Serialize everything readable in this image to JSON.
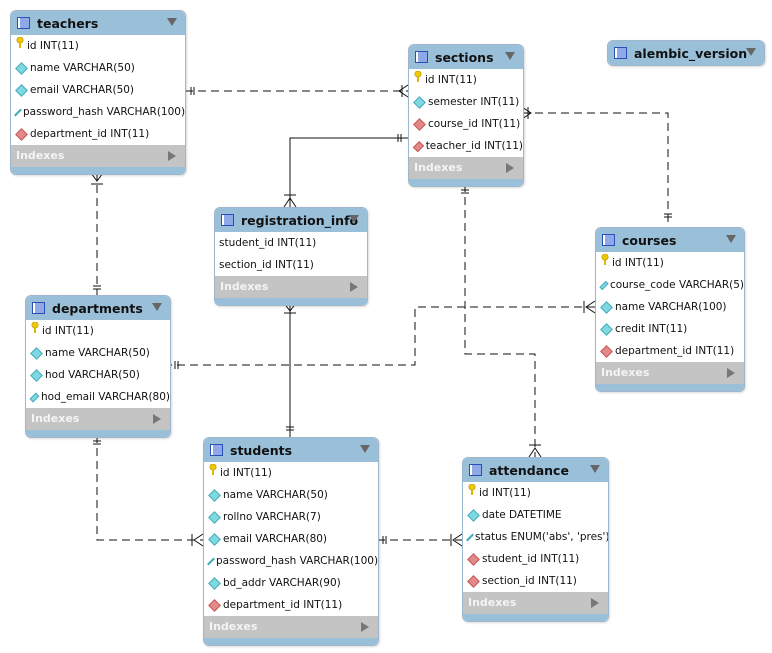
{
  "indexes_label": "Indexes",
  "tables": [
    {
      "id": "teachers",
      "name": "teachers",
      "columns": [
        {
          "kind": "pk",
          "text": "id INT(11)"
        },
        {
          "kind": "col",
          "text": "name VARCHAR(50)"
        },
        {
          "kind": "col",
          "text": "email VARCHAR(50)"
        },
        {
          "kind": "col",
          "text": "password_hash VARCHAR(100)"
        },
        {
          "kind": "fk",
          "text": "department_id INT(11)"
        }
      ]
    },
    {
      "id": "sections",
      "name": "sections",
      "columns": [
        {
          "kind": "pk",
          "text": "id INT(11)"
        },
        {
          "kind": "col",
          "text": "semester INT(11)"
        },
        {
          "kind": "fk",
          "text": "course_id INT(11)"
        },
        {
          "kind": "fk",
          "text": "teacher_id INT(11)"
        }
      ]
    },
    {
      "id": "alembic_version",
      "name": "alembic_version",
      "collapsed": true,
      "columns": []
    },
    {
      "id": "registration_info",
      "name": "registration_info",
      "columns": [
        {
          "kind": "none",
          "text": "student_id INT(11)"
        },
        {
          "kind": "none",
          "text": "section_id INT(11)"
        }
      ]
    },
    {
      "id": "courses",
      "name": "courses",
      "columns": [
        {
          "kind": "pk",
          "text": "id INT(11)"
        },
        {
          "kind": "col",
          "text": "course_code VARCHAR(5)"
        },
        {
          "kind": "col",
          "text": "name VARCHAR(100)"
        },
        {
          "kind": "col",
          "text": "credit INT(11)"
        },
        {
          "kind": "fk",
          "text": "department_id INT(11)"
        }
      ]
    },
    {
      "id": "departments",
      "name": "departments",
      "columns": [
        {
          "kind": "pk",
          "text": "id INT(11)"
        },
        {
          "kind": "col",
          "text": "name VARCHAR(50)"
        },
        {
          "kind": "col",
          "text": "hod VARCHAR(50)"
        },
        {
          "kind": "col",
          "text": "hod_email VARCHAR(80)"
        }
      ]
    },
    {
      "id": "students",
      "name": "students",
      "columns": [
        {
          "kind": "pk",
          "text": "id INT(11)"
        },
        {
          "kind": "col",
          "text": "name VARCHAR(50)"
        },
        {
          "kind": "col",
          "text": "rollno VARCHAR(7)"
        },
        {
          "kind": "col",
          "text": "email VARCHAR(80)"
        },
        {
          "kind": "col",
          "text": "password_hash VARCHAR(100)"
        },
        {
          "kind": "col",
          "text": "bd_addr VARCHAR(90)"
        },
        {
          "kind": "fk",
          "text": "department_id INT(11)"
        }
      ]
    },
    {
      "id": "attendance",
      "name": "attendance",
      "columns": [
        {
          "kind": "pk",
          "text": "id INT(11)"
        },
        {
          "kind": "col",
          "text": "date DATETIME"
        },
        {
          "kind": "col",
          "text": "status ENUM('abs', 'pres')"
        },
        {
          "kind": "fk",
          "text": "student_id INT(11)"
        },
        {
          "kind": "fk",
          "text": "section_id INT(11)"
        }
      ]
    }
  ],
  "relationships": [
    {
      "from": "teachers",
      "to": "sections",
      "style": "dashed"
    },
    {
      "from": "sections",
      "to": "registration_info",
      "style": "solid"
    },
    {
      "from": "courses",
      "to": "sections",
      "style": "dashed"
    },
    {
      "from": "departments",
      "to": "teachers",
      "style": "dashed"
    },
    {
      "from": "departments",
      "to": "courses",
      "style": "dashed"
    },
    {
      "from": "sections",
      "to": "attendance",
      "style": "dashed"
    },
    {
      "from": "students",
      "to": "registration_info",
      "style": "solid"
    },
    {
      "from": "departments",
      "to": "students",
      "style": "dashed"
    },
    {
      "from": "students",
      "to": "attendance",
      "style": "dashed"
    }
  ]
}
